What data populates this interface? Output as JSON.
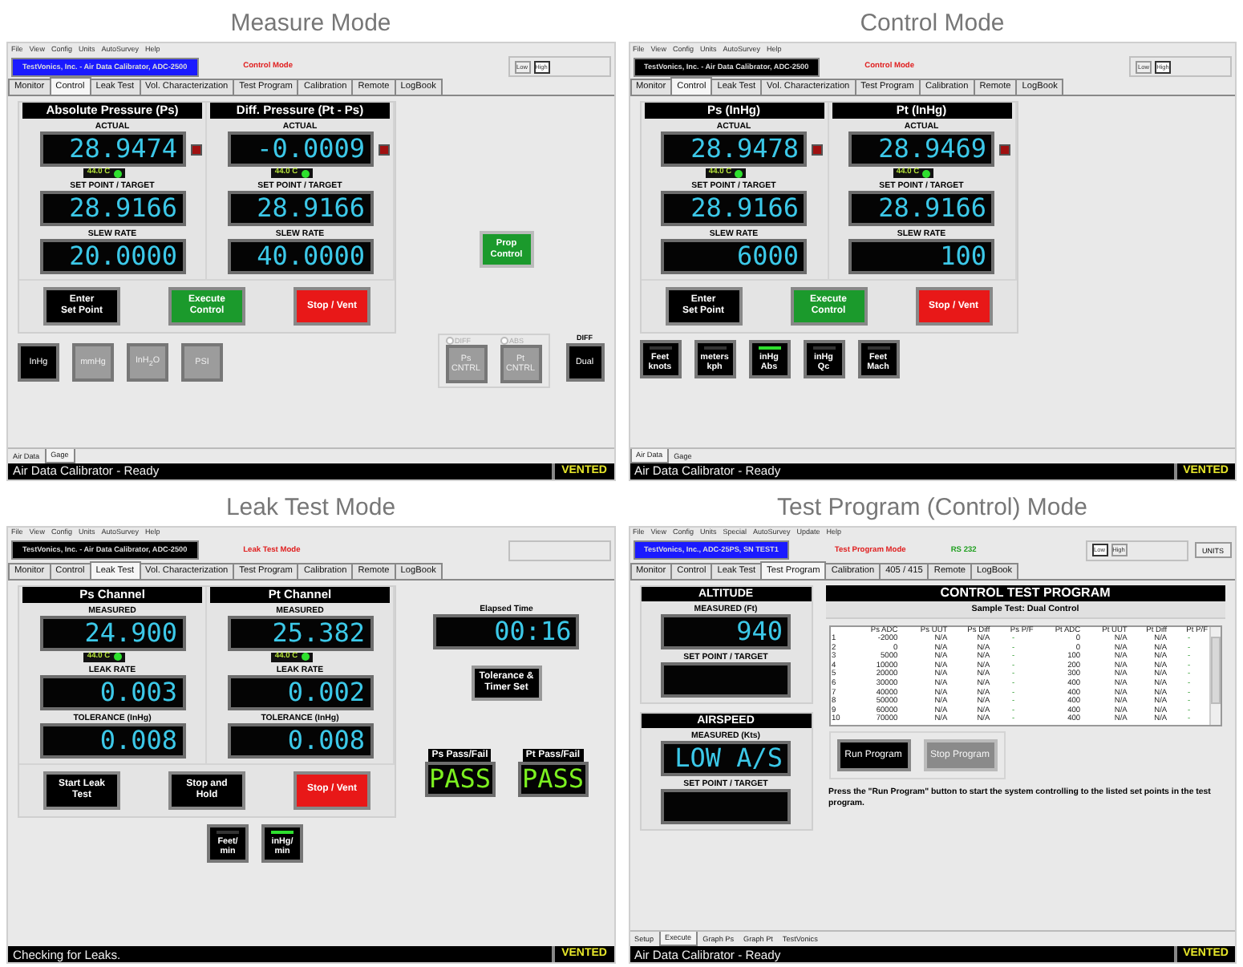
{
  "panels": [
    {
      "caption": "Measure Mode",
      "kind": "control",
      "menu": [
        "File",
        "View",
        "Config",
        "Units",
        "AutoSurvey",
        "Help"
      ],
      "header": {
        "title": "TestVonics, Inc. - Air Data Calibrator, ADC-2500",
        "highlighted": true,
        "mode": "Control Mode",
        "range_buttons": [
          {
            "label": "Low",
            "selected": false
          },
          {
            "label": "High",
            "selected": true
          }
        ]
      },
      "tabs": [
        {
          "label": "Monitor",
          "selected": false
        },
        {
          "label": "Control",
          "selected": true
        },
        {
          "label": "Leak Test",
          "selected": false
        },
        {
          "label": "Vol. Characterization",
          "selected": false
        },
        {
          "label": "Test Program",
          "selected": false
        },
        {
          "label": "Calibration",
          "selected": false
        },
        {
          "label": "Remote",
          "selected": false
        },
        {
          "label": "LogBook",
          "selected": false
        }
      ],
      "channels": [
        {
          "title": "Absolute Pressure (Ps)",
          "readouts": [
            {
              "label": "ACTUAL",
              "value": "28.9474",
              "lamp": true,
              "temp": "44.0 C"
            },
            {
              "label": "SET POINT / TARGET",
              "value": "28.9166"
            },
            {
              "label": "SLEW RATE",
              "value": "20.0000"
            }
          ]
        },
        {
          "title": "Diff. Pressure (Pt - Ps)",
          "readouts": [
            {
              "label": "ACTUAL",
              "value": "-0.0009",
              "lamp": true,
              "temp": "44.0 C"
            },
            {
              "label": "SET POINT / TARGET",
              "value": "28.9166"
            },
            {
              "label": "SLEW RATE",
              "value": "40.0000"
            }
          ]
        }
      ],
      "actions": [
        {
          "lines": [
            "Enter",
            "Set Point"
          ],
          "kind": "black"
        },
        {
          "lines": [
            "Execute",
            "Control"
          ],
          "kind": "green"
        },
        {
          "lines": [
            "Stop / Vent"
          ],
          "kind": "red"
        }
      ],
      "unit_buttons": [
        {
          "kind": "fill",
          "lines": [
            "InHg"
          ],
          "selected": true
        },
        {
          "kind": "fill",
          "lines": [
            "mmHg"
          ],
          "selected": false
        },
        {
          "kind": "fill",
          "lines": [
            "InH$_{2}$O"
          ],
          "selected": false
        },
        {
          "kind": "fill",
          "lines": [
            "PSI"
          ],
          "selected": false
        }
      ],
      "side": {
        "prop_button": [
          "Prop",
          "Control"
        ],
        "options": [
          {
            "label": "DIFF",
            "selected": false
          },
          {
            "label": "ABS",
            "selected": false
          }
        ],
        "control_buttons": [
          [
            "Ps",
            "CNTRL"
          ],
          [
            "Pt",
            "CNTRL"
          ]
        ],
        "dual_label": "DIFF",
        "dual_button": "Dual"
      },
      "bottom_tabs": [
        {
          "label": "Air Data",
          "selected": false
        },
        {
          "label": "Gage",
          "selected": true
        }
      ],
      "status": {
        "text": "Air Data Calibrator - Ready",
        "state": "VENTED"
      }
    },
    {
      "caption": "Control Mode",
      "kind": "control",
      "menu": [
        "File",
        "View",
        "Config",
        "Units",
        "AutoSurvey",
        "Help"
      ],
      "header": {
        "title": "TestVonics, Inc. - Air Data Calibrator, ADC-2500",
        "highlighted": false,
        "mode": "Control Mode",
        "range_buttons": [
          {
            "label": "Low",
            "selected": false
          },
          {
            "label": "High",
            "selected": true
          }
        ]
      },
      "tabs": [
        {
          "label": "Monitor",
          "selected": false
        },
        {
          "label": "Control",
          "selected": true
        },
        {
          "label": "Leak Test",
          "selected": false
        },
        {
          "label": "Vol. Characterization",
          "selected": false
        },
        {
          "label": "Test Program",
          "selected": false
        },
        {
          "label": "Calibration",
          "selected": false
        },
        {
          "label": "Remote",
          "selected": false
        },
        {
          "label": "LogBook",
          "selected": false
        }
      ],
      "channels": [
        {
          "title": "Ps (InHg)",
          "readouts": [
            {
              "label": "ACTUAL",
              "value": "28.9478",
              "lamp": true,
              "temp": "44.0 C"
            },
            {
              "label": "SET POINT / TARGET",
              "value": "28.9166"
            },
            {
              "label": "SLEW RATE",
              "value": "6000"
            }
          ]
        },
        {
          "title": "Pt (InHg)",
          "readouts": [
            {
              "label": "ACTUAL",
              "value": "28.9469",
              "lamp": true,
              "temp": "44.0 C"
            },
            {
              "label": "SET POINT / TARGET",
              "value": "28.9166"
            },
            {
              "label": "SLEW RATE",
              "value": "100"
            }
          ]
        }
      ],
      "actions": [
        {
          "lines": [
            "Enter",
            "Set Point"
          ],
          "kind": "black"
        },
        {
          "lines": [
            "Execute",
            "Control"
          ],
          "kind": "green"
        },
        {
          "lines": [
            "Stop / Vent"
          ],
          "kind": "red"
        }
      ],
      "unit_buttons": [
        {
          "kind": "lamp",
          "lines": [
            "Feet",
            "knots"
          ],
          "selected": false
        },
        {
          "kind": "lamp",
          "lines": [
            "meters",
            "kph"
          ],
          "selected": false
        },
        {
          "kind": "lamp",
          "lines": [
            "inHg",
            "Abs"
          ],
          "selected": true
        },
        {
          "kind": "lamp",
          "lines": [
            "inHg",
            "Qc"
          ],
          "selected": false
        },
        {
          "kind": "lamp",
          "lines": [
            "Feet",
            "Mach"
          ],
          "selected": false
        }
      ],
      "bottom_tabs": [
        {
          "label": "Air Data",
          "selected": true
        },
        {
          "label": "Gage",
          "selected": false
        }
      ],
      "status": {
        "text": "Air Data Calibrator - Ready",
        "state": "VENTED"
      }
    },
    {
      "caption": "Leak Test Mode",
      "kind": "leak",
      "menu": [
        "File",
        "View",
        "Config",
        "Units",
        "AutoSurvey",
        "Help"
      ],
      "header": {
        "title": "TestVonics, Inc. - Air Data Calibrator, ADC-2500",
        "highlighted": false,
        "mode": "Leak Test Mode"
      },
      "tabs": [
        {
          "label": "Monitor",
          "selected": false
        },
        {
          "label": "Control",
          "selected": false
        },
        {
          "label": "Leak Test",
          "selected": true
        },
        {
          "label": "Vol. Characterization",
          "selected": false
        },
        {
          "label": "Test Program",
          "selected": false
        },
        {
          "label": "Calibration",
          "selected": false
        },
        {
          "label": "Remote",
          "selected": false
        },
        {
          "label": "LogBook",
          "selected": false
        }
      ],
      "channels": [
        {
          "title": "Ps Channel",
          "readouts": [
            {
              "label": "MEASURED",
              "value": "24.900",
              "temp": "44.0 C"
            },
            {
              "label": "LEAK RATE",
              "value": "0.003"
            },
            {
              "label": "TOLERANCE (InHg)",
              "value": "0.008"
            }
          ]
        },
        {
          "title": "Pt Channel",
          "readouts": [
            {
              "label": "MEASURED",
              "value": "25.382",
              "temp": "44.0 C"
            },
            {
              "label": "LEAK RATE",
              "value": "0.002"
            },
            {
              "label": "TOLERANCE (InHg)",
              "value": "0.008"
            }
          ]
        }
      ],
      "actions": [
        {
          "lines": [
            "Start Leak",
            "Test"
          ],
          "kind": "black"
        },
        {
          "lines": [
            "Stop and",
            "Hold"
          ],
          "kind": "black"
        },
        {
          "lines": [
            "Stop / Vent"
          ],
          "kind": "red"
        }
      ],
      "timer": {
        "label": "Elapsed Time",
        "value": "00:16"
      },
      "settings_button": [
        "Tolerance &",
        "Timer Set"
      ],
      "pass_fail": [
        {
          "title": "Ps Pass/Fail",
          "value": "PASS"
        },
        {
          "title": "Pt Pass/Fail",
          "value": "PASS"
        }
      ],
      "unit_buttons": [
        {
          "kind": "lamp",
          "lines": [
            "Feet/",
            "min"
          ],
          "selected": false
        },
        {
          "kind": "lamp",
          "lines": [
            "inHg/",
            "min"
          ],
          "selected": true
        }
      ],
      "status": {
        "text": "Checking for Leaks.",
        "state": "VENTED"
      }
    },
    {
      "caption": "Test Program (Control) Mode",
      "kind": "program",
      "menu": [
        "File",
        "View",
        "Config",
        "Units",
        "Special",
        "AutoSurvey",
        "Update",
        "Help"
      ],
      "header": {
        "title": "TestVonics, Inc., ADC-25PS, SN TEST1",
        "highlighted": true,
        "mode": "Test Program Mode",
        "extra": "RS 232",
        "range_buttons": [
          {
            "label": "Low",
            "selected": true
          },
          {
            "label": "High",
            "selected": false
          }
        ],
        "units_button": "UNITS"
      },
      "tabs": [
        {
          "label": "Monitor",
          "selected": false
        },
        {
          "label": "Control",
          "selected": false
        },
        {
          "label": "Leak Test",
          "selected": false
        },
        {
          "label": "Test Program",
          "selected": true
        },
        {
          "label": "Calibration",
          "selected": false
        },
        {
          "label": "405 / 415",
          "selected": false
        },
        {
          "label": "Remote",
          "selected": false
        },
        {
          "label": "LogBook",
          "selected": false
        }
      ],
      "sections": [
        {
          "title": "ALTITUDE",
          "readouts": [
            {
              "label": "MEASURED (Ft)",
              "value": "940"
            },
            {
              "label": "SET POINT / TARGET"
            }
          ]
        },
        {
          "title": "AIRSPEED",
          "readouts": [
            {
              "label": "MEASURED (Kts)",
              "value": "LOW A/S"
            },
            {
              "label": "SET POINT / TARGET"
            }
          ]
        }
      ],
      "program": {
        "title": "CONTROL TEST PROGRAM",
        "subtitle": "Sample Test: Dual Control",
        "columns": [
          "",
          "Ps ADC",
          "Ps UUT",
          "Ps Diff",
          "Ps P/F",
          "Pt ADC",
          "Pt UUT",
          "Pt Diff",
          "Pt P/F"
        ],
        "rows": [
          [
            "1",
            "-2000",
            "N/A",
            "N/A",
            "-",
            "0",
            "N/A",
            "N/A",
            "-"
          ],
          [
            "2",
            "0",
            "N/A",
            "N/A",
            "-",
            "0",
            "N/A",
            "N/A",
            "-"
          ],
          [
            "3",
            "5000",
            "N/A",
            "N/A",
            "-",
            "100",
            "N/A",
            "N/A",
            "-"
          ],
          [
            "4",
            "10000",
            "N/A",
            "N/A",
            "-",
            "200",
            "N/A",
            "N/A",
            "-"
          ],
          [
            "5",
            "20000",
            "N/A",
            "N/A",
            "-",
            "300",
            "N/A",
            "N/A",
            "-"
          ],
          [
            "6",
            "30000",
            "N/A",
            "N/A",
            "-",
            "400",
            "N/A",
            "N/A",
            "-"
          ],
          [
            "7",
            "40000",
            "N/A",
            "N/A",
            "-",
            "400",
            "N/A",
            "N/A",
            "-"
          ],
          [
            "8",
            "50000",
            "N/A",
            "N/A",
            "-",
            "400",
            "N/A",
            "N/A",
            "-"
          ],
          [
            "9",
            "60000",
            "N/A",
            "N/A",
            "-",
            "400",
            "N/A",
            "N/A",
            "-"
          ],
          [
            "10",
            "70000",
            "N/A",
            "N/A",
            "-",
            "400",
            "N/A",
            "N/A",
            "-"
          ]
        ],
        "buttons": [
          {
            "label": "Run Program",
            "disabled": false
          },
          {
            "label": "Stop Program",
            "disabled": true
          }
        ],
        "note": "Press the \"Run Program\" button to start the system controlling to the listed set points in the test program."
      },
      "bottom_tabs": [
        {
          "label": "Setup",
          "selected": false
        },
        {
          "label": "Execute",
          "selected": true
        },
        {
          "label": "Graph Ps",
          "selected": false
        },
        {
          "label": "Graph Pt",
          "selected": false
        },
        {
          "label": "TestVonics",
          "selected": false
        }
      ],
      "status": {
        "text": "Air Data Calibrator - Ready",
        "state": "VENTED"
      }
    }
  ]
}
